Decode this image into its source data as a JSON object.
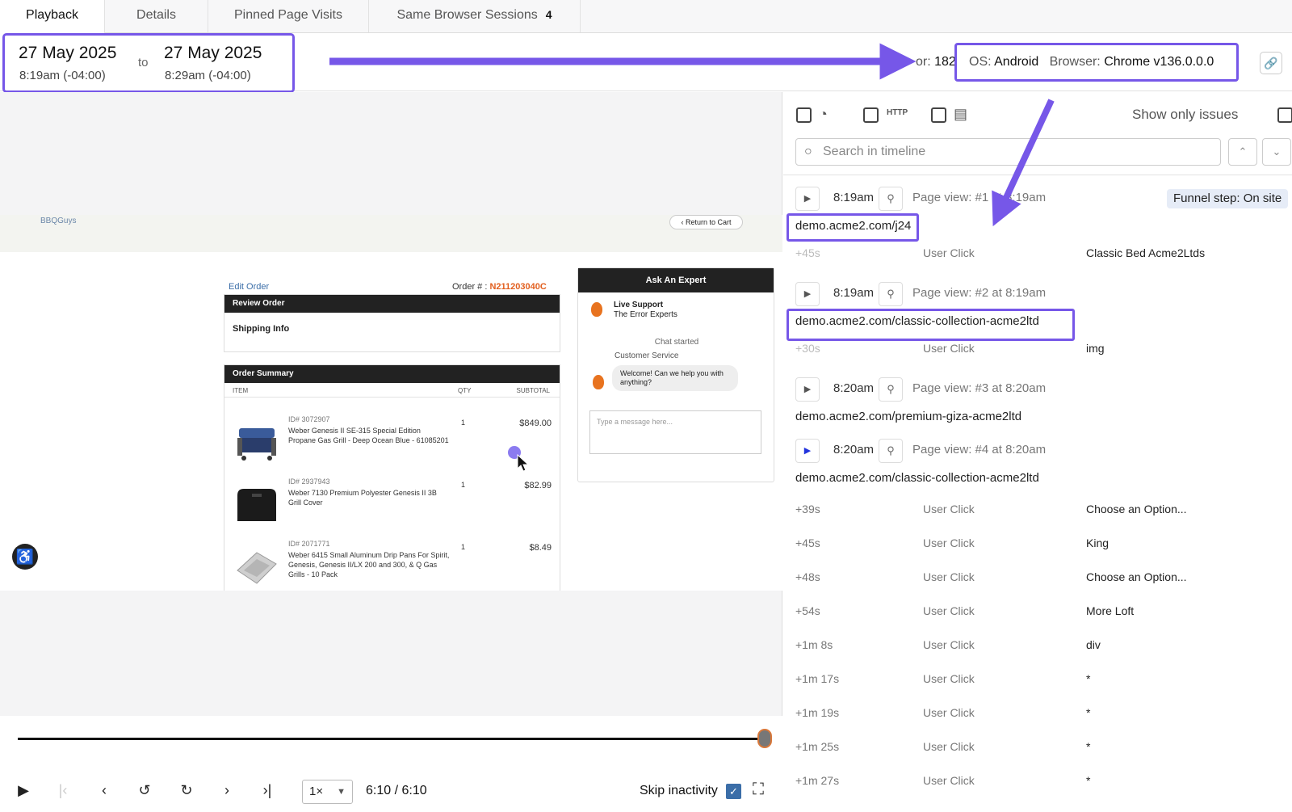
{
  "tabs": [
    {
      "label": "Playback"
    },
    {
      "label": "Details"
    },
    {
      "label": "Pinned Page Visits"
    },
    {
      "label": "Same Browser Sessions",
      "count": "4"
    }
  ],
  "session": {
    "start_date": "27 May 2025",
    "start_time": "8:19am (-04:00)",
    "to": "to",
    "end_date": "27 May 2025",
    "end_time": "8:29am (-04:00)",
    "visitor_prefix": "or:",
    "visitor_value": "182",
    "os_label": "OS:",
    "os_value": "Android",
    "browser_label": "Browser:",
    "browser_value": "Chrome v136.0.0.0"
  },
  "site": {
    "logo_alt": "BBQGuys",
    "return_cart": "Return to Cart",
    "edit_order": "Edit Order",
    "order_label": "Order # :",
    "order_number": "N211203040C",
    "review_title": "Review Order",
    "shipping_info": "Shipping Info",
    "summary_title": "Order Summary",
    "col_item": "ITEM",
    "col_qty": "QTY",
    "col_subtotal": "SUBTOTAL",
    "items": [
      {
        "sku": "ID# 3072907",
        "name": "Weber Genesis II SE-315 Special Edition Propane Gas Grill - Deep Ocean Blue - 61085201",
        "qty": "1",
        "price": "$849.00"
      },
      {
        "sku": "ID# 2937943",
        "name": "Weber 7130 Premium Polyester Genesis II 3B Grill Cover",
        "qty": "1",
        "price": "$82.99"
      },
      {
        "sku": "ID# 2071771",
        "name": "Weber 6415 Small Aluminum Drip Pans For Spirit, Genesis, Genesis II/LX 200 and 300, & Q Gas Grills - 10 Pack",
        "qty": "1",
        "price": "$8.49"
      }
    ],
    "expert_title": "Ask An Expert",
    "live_support": "Live Support",
    "experts": "The Error Experts",
    "chat_started": "Chat started",
    "customer_service": "Customer Service",
    "welcome": "Welcome! Can we help you with anything?",
    "message_placeholder": "Type a message here..."
  },
  "controls": {
    "speed": "1×",
    "time": "6:10 / 6:10",
    "skip_inactivity": "Skip inactivity",
    "progress": 1.0
  },
  "panel": {
    "http_label": "HTTP",
    "show_only_issues": "Show only issues",
    "search_placeholder": "Search in timeline",
    "funnel": "Funnel step: On site",
    "page_views": [
      {
        "time": "8:19am",
        "label": "Page view: #1 at 8:19am",
        "url": "demo.acme2.com/j24"
      },
      {
        "time": "8:19am",
        "label": "Page view: #2  at 8:19am",
        "url": "demo.acme2.com/classic-collection-acme2ltd"
      },
      {
        "time": "8:20am",
        "label": "Page view: #3  at 8:20am",
        "url": "demo.acme2.com/premium-giza-acme2ltd"
      },
      {
        "time": "8:20am",
        "label": "Page view: #4  at 8:20am",
        "url": "demo.acme2.com/classic-collection-acme2ltd"
      }
    ],
    "events_pv1": [
      {
        "offset": "+45s",
        "type": "User Click",
        "target": "Classic Bed Acme2Ltds"
      }
    ],
    "events_pv2": [
      {
        "offset": "+30s",
        "type": "User Click",
        "target": "img"
      }
    ],
    "events_pv4": [
      {
        "offset": "+39s",
        "type": "User Click",
        "target": "Choose an Option..."
      },
      {
        "offset": "+45s",
        "type": "User Click",
        "target": "King"
      },
      {
        "offset": "+48s",
        "type": "User Click",
        "target": "Choose an Option..."
      },
      {
        "offset": "+54s",
        "type": "User Click",
        "target": "More Loft"
      },
      {
        "offset": "+1m 8s",
        "type": "User Click",
        "target": "div"
      },
      {
        "offset": "+1m 17s",
        "type": "User Click",
        "target": "*"
      },
      {
        "offset": "+1m 19s",
        "type": "User Click",
        "target": "*"
      },
      {
        "offset": "+1m 25s",
        "type": "User Click",
        "target": "*"
      },
      {
        "offset": "+1m 27s",
        "type": "User Click",
        "target": "*"
      }
    ]
  },
  "colors": {
    "annotation": "#7657e8",
    "order_number": "#e25f1e",
    "checkbox_blue": "#3b6ea8"
  }
}
